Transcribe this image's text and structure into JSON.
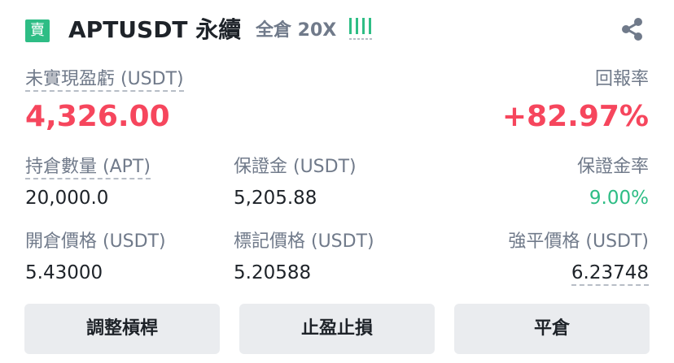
{
  "header": {
    "side_badge": "賣",
    "symbol": "APTUSDT 永續",
    "margin_mode": "全倉 20X"
  },
  "pnl": {
    "label": "未實現盈虧 (USDT)",
    "value": "4,326.00",
    "roe_label": "回報率",
    "roe_value": "+82.97%"
  },
  "stats_row1": {
    "size_label": "持倉數量 (APT)",
    "size_value": "20,000.0",
    "margin_label": "保證金 (USDT)",
    "margin_value": "5,205.88",
    "margin_ratio_label": "保證金率",
    "margin_ratio_value": "9.00%"
  },
  "stats_row2": {
    "entry_label": "開倉價格 (USDT)",
    "entry_value": "5.43000",
    "mark_label": "標記價格 (USDT)",
    "mark_value": "5.20588",
    "liq_label": "強平價格 (USDT)",
    "liq_value": "6.23748"
  },
  "buttons": {
    "adjust_leverage": "調整槓桿",
    "tp_sl": "止盈止損",
    "close": "平倉"
  },
  "colors": {
    "red": "#f6465d",
    "green": "#2ebd85",
    "grey": "#707a8a"
  },
  "icons": {
    "leverage": "leverage-bars-icon",
    "share": "share-icon"
  }
}
